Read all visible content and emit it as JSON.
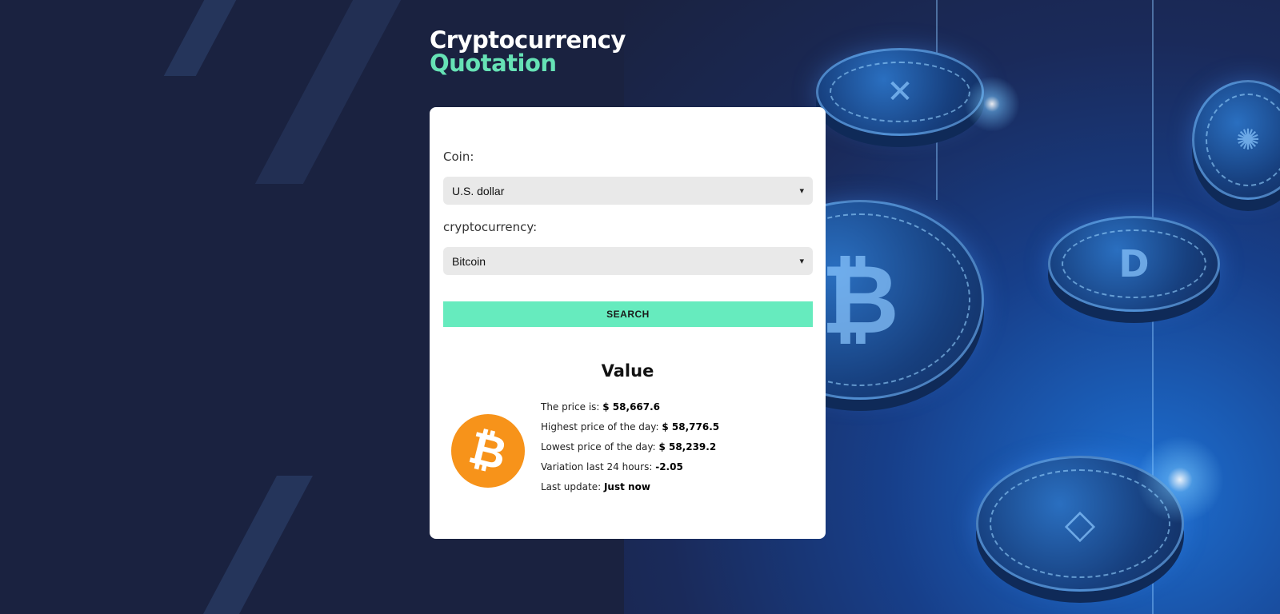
{
  "header": {
    "title_line1": "Cryptocurrency",
    "title_line2": "Quotation"
  },
  "form": {
    "coin_label": "Coin:",
    "coin_selected": "U.S. dollar",
    "crypto_label": "cryptocurrency:",
    "crypto_selected": "Bitcoin",
    "search_label": "SEARCH"
  },
  "result": {
    "title": "Value",
    "icon": "bitcoin-icon",
    "rows": [
      {
        "label": "The price is:",
        "value": "$ 58,667.6"
      },
      {
        "label": "Highest price of the day:",
        "value": "$ 58,776.5"
      },
      {
        "label": "Lowest price of the day:",
        "value": "$ 58,239.2"
      },
      {
        "label": "Variation last 24 hours:",
        "value": "-2.05"
      },
      {
        "label": "Last update:",
        "value": "Just now"
      }
    ]
  },
  "colors": {
    "background": "#1a2240",
    "accent": "#66e2b5",
    "button": "#66ebbe",
    "bitcoin": "#f7931a"
  }
}
